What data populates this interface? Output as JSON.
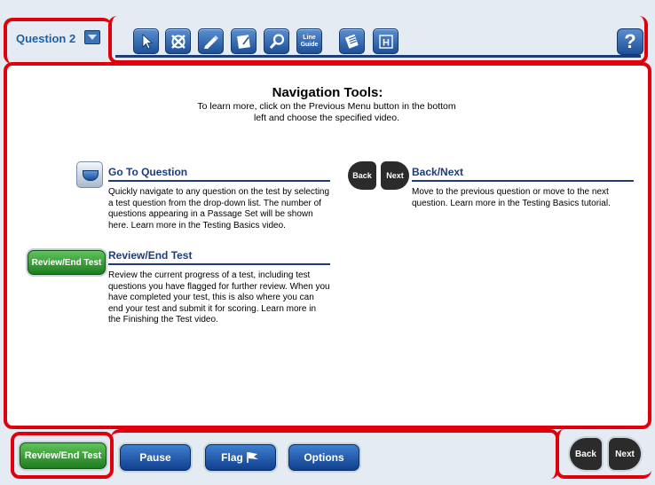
{
  "question_selector": {
    "label": "Question 2"
  },
  "toolbar": {
    "tools": [
      {
        "icon": "pointer-icon"
      },
      {
        "icon": "eliminate-icon"
      },
      {
        "icon": "highlighter-icon"
      },
      {
        "icon": "notepad-icon"
      },
      {
        "icon": "magnifier-icon"
      },
      {
        "icon": "line-guide-icon",
        "label_line1": "Line",
        "label_line2": "Guide"
      },
      {
        "icon": "reference-sheet-icon"
      },
      {
        "icon": "formula-sheet-icon",
        "label": "H"
      }
    ],
    "help_label": "?"
  },
  "main": {
    "title": "Navigation Tools:",
    "subtitle": "To learn more, click on the Previous Menu button in the bottom left and choose the specified video.",
    "go_to_question": {
      "heading": "Go To Question",
      "body": "Quickly navigate to any question on the test by selecting a test question from the drop-down list. The number of questions appearing in a Passage Set will be shown here. Learn more in the Testing Basics video."
    },
    "review_end": {
      "icon_label": "Review/End Test",
      "heading": "Review/End Test",
      "body": "Review the current progress of a test, including test questions you have flagged for further review. When you have completed your test, this is also where you can end your test and submit it for scoring. Learn more in the Finishing the Test video."
    },
    "back_next": {
      "back_label": "Back",
      "next_label": "Next",
      "heading": "Back/Next",
      "body": "Move to the previous question or move to the next question. Learn more in the Testing Basics tutorial."
    }
  },
  "bottom": {
    "review_label": "Review/End Test",
    "pause_label": "Pause",
    "flag_label": "Flag",
    "options_label": "Options",
    "back_label": "Back",
    "next_label": "Next"
  },
  "colors": {
    "highlight_border": "#e0000c",
    "heading_blue": "#1d3c78",
    "button_blue": "#1d4f96",
    "button_green": "#1f7d20"
  }
}
